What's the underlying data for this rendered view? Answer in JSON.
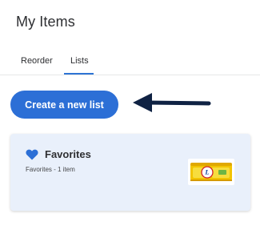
{
  "page": {
    "title": "My Items"
  },
  "tabs": [
    {
      "label": "Reorder",
      "active": false
    },
    {
      "label": "Lists",
      "active": true
    }
  ],
  "actions": {
    "create_list_label": "Create a new list"
  },
  "lists": [
    {
      "name": "Favorites",
      "summary": "Favorites - 1 item",
      "icon": "heart-icon",
      "thumbnail": "product-thumbnail"
    }
  ],
  "colors": {
    "accent": "#2c6fd6",
    "tab_underline": "#2e74d4",
    "card_background": "#e9f0fb",
    "arrow": "#0f2243",
    "heart": "#2c6fd6"
  }
}
